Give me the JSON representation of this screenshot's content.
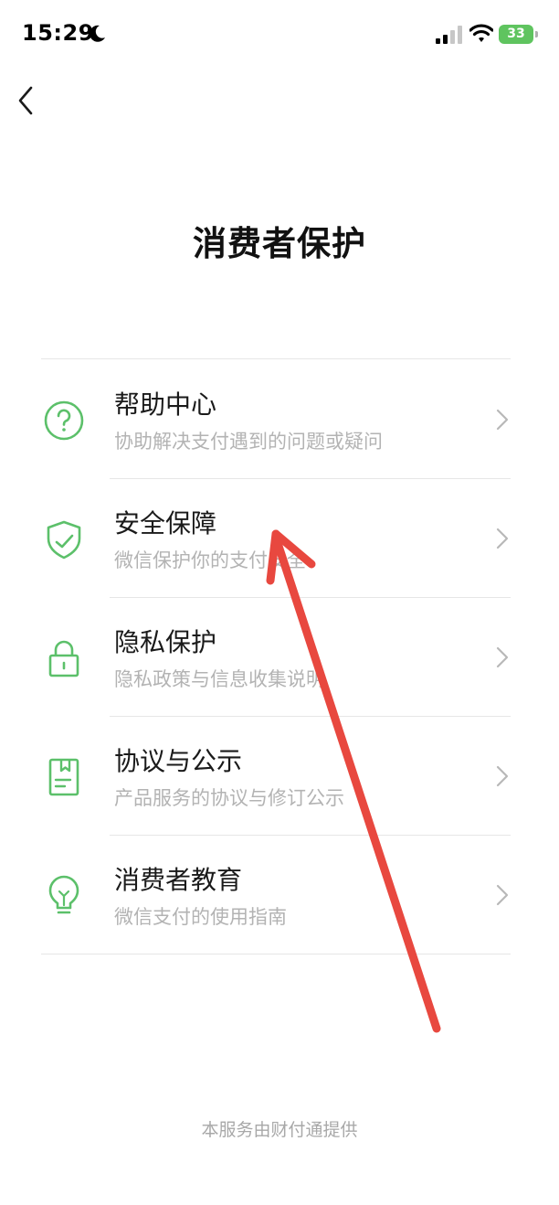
{
  "status_bar": {
    "time": "15:29",
    "battery": "33"
  },
  "page": {
    "title": "消费者保护"
  },
  "menu": {
    "items": [
      {
        "title": "帮助中心",
        "subtitle": "协助解决支付遇到的问题或疑问",
        "icon": "help-circle-icon"
      },
      {
        "title": "安全保障",
        "subtitle": "微信保护你的支付安全",
        "icon": "shield-check-icon"
      },
      {
        "title": "隐私保护",
        "subtitle": "隐私政策与信息收集说明",
        "icon": "lock-icon"
      },
      {
        "title": "协议与公示",
        "subtitle": "产品服务的协议与修订公示",
        "icon": "document-icon"
      },
      {
        "title": "消费者教育",
        "subtitle": "微信支付的使用指南",
        "icon": "lightbulb-icon"
      }
    ]
  },
  "footer": {
    "text": "本服务由财付通提供"
  },
  "colors": {
    "accent": "#5cc06a",
    "annotation_arrow": "#e8483f"
  }
}
